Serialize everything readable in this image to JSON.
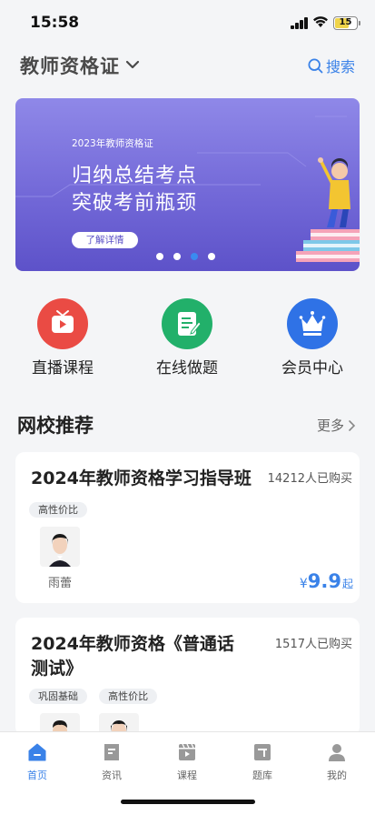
{
  "status": {
    "time": "15:58",
    "battery": "15"
  },
  "header": {
    "category": "教师资格证",
    "search_label": "搜索"
  },
  "banner": {
    "small_title": "2023年教师资格证",
    "line1": "归纳总结考点",
    "line2": "突破考前瓶颈",
    "button": "了解详情",
    "active_dot": 2,
    "dot_count": 4
  },
  "quick": [
    {
      "label": "直播课程",
      "icon": "tv-icon",
      "color": "#ea4b44"
    },
    {
      "label": "在线做题",
      "icon": "exam-icon",
      "color": "#22b06a"
    },
    {
      "label": "会员中心",
      "icon": "crown-icon",
      "color": "#2f72e6"
    }
  ],
  "section": {
    "title": "网校推荐",
    "more": "更多"
  },
  "courses": [
    {
      "title": "2024年教师资格学习指导班",
      "sold": "14212人已购买",
      "tags": [
        "高性价比"
      ],
      "teachers": [
        "雨蕾"
      ],
      "price_currency": "¥",
      "price_value": "9.9",
      "price_suffix": "起"
    },
    {
      "title_line1": "2024年教师资格《普通话",
      "title_line2": "测试》",
      "sold": "1517人已购买",
      "tags": [
        "巩固基础",
        "高性价比"
      ]
    }
  ],
  "tabs": [
    {
      "label": "首页",
      "icon": "home-icon",
      "active": true
    },
    {
      "label": "资讯",
      "icon": "news-icon",
      "active": false
    },
    {
      "label": "课程",
      "icon": "course-icon",
      "active": false
    },
    {
      "label": "题库",
      "icon": "question-bank-icon",
      "active": false
    },
    {
      "label": "我的",
      "icon": "profile-icon",
      "active": false
    }
  ],
  "colors": {
    "accent": "#3a82e8",
    "banner": "#7369d8",
    "live": "#ea4b44",
    "exam": "#22b06a",
    "vip": "#2f72e6"
  }
}
